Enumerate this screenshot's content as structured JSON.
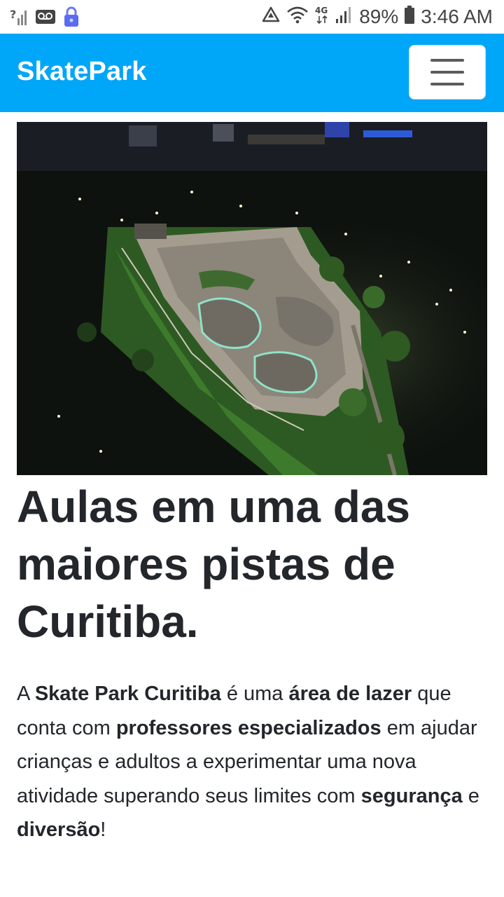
{
  "status_bar": {
    "battery_percent": "89%",
    "time": "3:46 AM",
    "network_type": "4G",
    "icons": [
      "unknown-signal-icon",
      "voicemail-icon",
      "lock-icon",
      "recycle-icon",
      "wifi-icon",
      "network-4g-icon",
      "signal-icon",
      "battery-icon"
    ]
  },
  "navbar": {
    "brand": "SkatePark",
    "background": "#00a6f8",
    "menu_icon": "hamburger-icon"
  },
  "hero": {
    "image": "aerial-night-skatepark-photo"
  },
  "content": {
    "headline": "Aulas em uma das maiores pistas de Curitiba.",
    "paragraph": {
      "t1": "A ",
      "b1": "Skate Park Curitiba",
      "t2": " é uma ",
      "b2": "área de lazer",
      "t3": " que conta com ",
      "b3": "professores especializados",
      "t4": " em ajudar crianças e adultos a experimentar uma nova atividade superando seus limites com ",
      "b4": "segurança",
      "t5": " e ",
      "b5": "diversão",
      "t6": "!"
    }
  }
}
